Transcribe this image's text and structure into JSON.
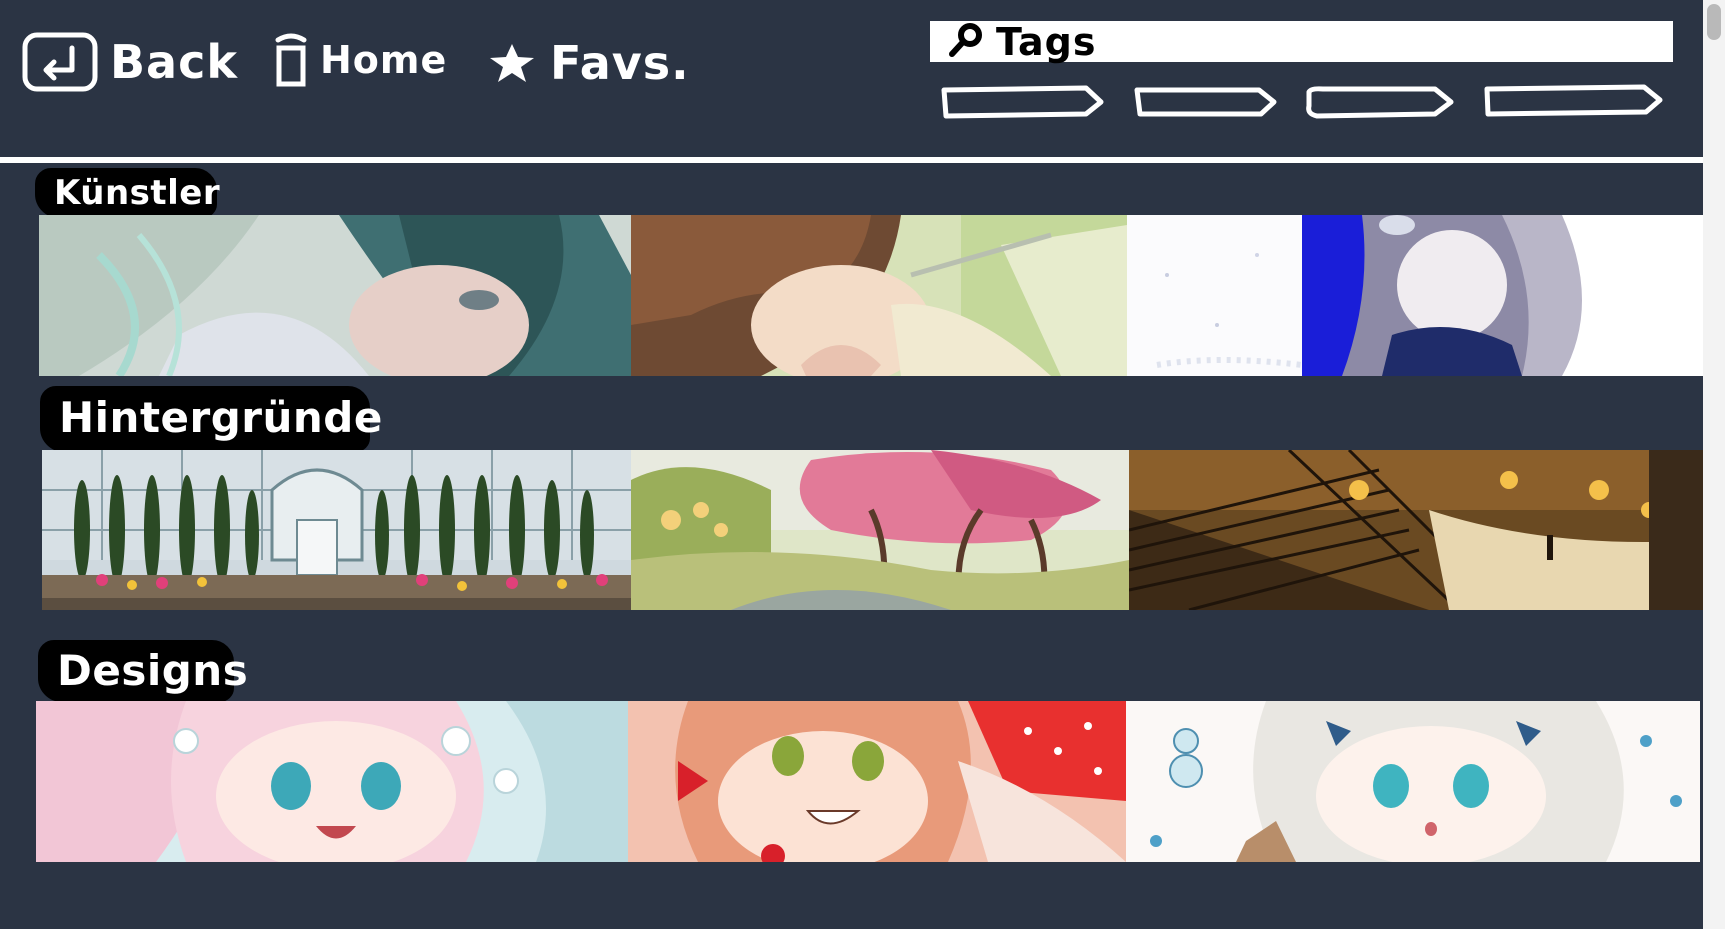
{
  "nav": {
    "back_label": "Back",
    "home_label": "Home",
    "favs_label": "Favs."
  },
  "search": {
    "placeholder": "Tags"
  },
  "tag_chips": [
    {
      "label": ""
    },
    {
      "label": ""
    },
    {
      "label": ""
    },
    {
      "label": ""
    }
  ],
  "sections": [
    {
      "title": "Künstler",
      "tiles": 3
    },
    {
      "title": "Hintergründe",
      "tiles": 3
    },
    {
      "title": "Designs",
      "tiles": 3
    }
  ],
  "colors": {
    "background": "#2b3444",
    "header_text": "#ffffff",
    "label_bg": "#000000"
  },
  "icons": [
    "back-icon",
    "home-icon",
    "star-icon",
    "search-icon"
  ]
}
